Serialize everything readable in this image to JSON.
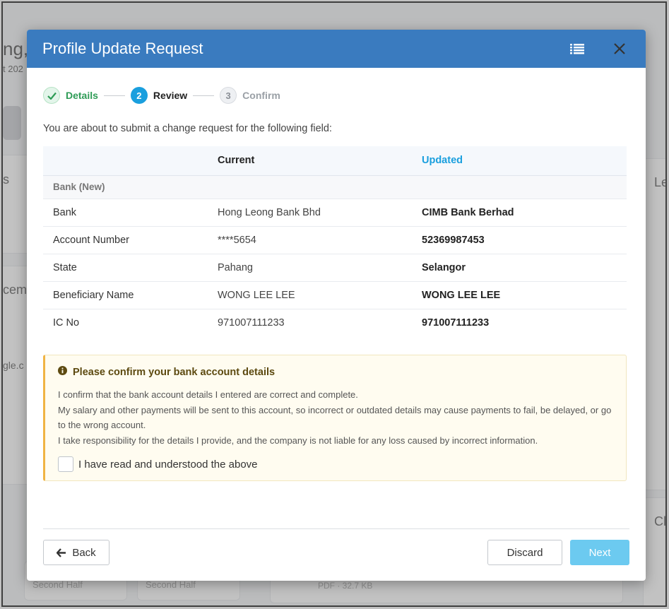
{
  "background": {
    "frag_title": "ng,",
    "frag_sub": "t 202",
    "frag_s": "s",
    "frag_le": "Le",
    "frag_cem": "cem",
    "frag_gle": "gle.c",
    "frag_cl": "Cl",
    "frag_half1": "Second Half",
    "frag_half2": "Second Half",
    "frag_pdf": "PDF · 32.7 KB"
  },
  "modal": {
    "title": "Profile Update Request",
    "list_icon": "list-icon",
    "close_icon": "close-icon"
  },
  "stepper": {
    "steps": [
      {
        "number": "✓",
        "label": "Details",
        "state": "done"
      },
      {
        "number": "2",
        "label": "Review",
        "state": "active"
      },
      {
        "number": "3",
        "label": "Confirm",
        "state": "todo"
      }
    ]
  },
  "intro": "You are about to submit a change request for the following field:",
  "table": {
    "headers": [
      "",
      "Current",
      "Updated"
    ],
    "group": "Bank (New)",
    "rows": [
      {
        "field": "Bank",
        "current": "Hong Leong Bank Bhd",
        "updated": "CIMB Bank Berhad"
      },
      {
        "field": "Account Number",
        "current": "****5654",
        "updated": "52369987453"
      },
      {
        "field": "State",
        "current": "Pahang",
        "updated": "Selangor"
      },
      {
        "field": "Beneficiary Name",
        "current": "WONG LEE LEE",
        "updated": "WONG LEE LEE"
      },
      {
        "field": "IC No",
        "current": "971007111233",
        "updated": "971007111233"
      }
    ]
  },
  "alert": {
    "icon": "info-circle-icon",
    "title": "Please confirm your bank account details",
    "lines": [
      "I confirm that the bank account details I entered are correct and complete.",
      "My salary and other payments will be sent to this account, so incorrect or outdated details may cause payments to fail, be delayed, or go to the wrong account.",
      "I take responsibility for the details I provide, and the company is not liable for any loss caused by incorrect information."
    ],
    "checkbox_label": "I have read and understood the above",
    "checked": false
  },
  "footer": {
    "back_label": "Back",
    "discard_label": "Discard",
    "next_label": "Next"
  },
  "colors": {
    "header": "#3a7bbf",
    "accent": "#1a9fde",
    "success": "#2e9c56",
    "warning_border": "#f0b444",
    "next_button": "#6ccaf0"
  }
}
